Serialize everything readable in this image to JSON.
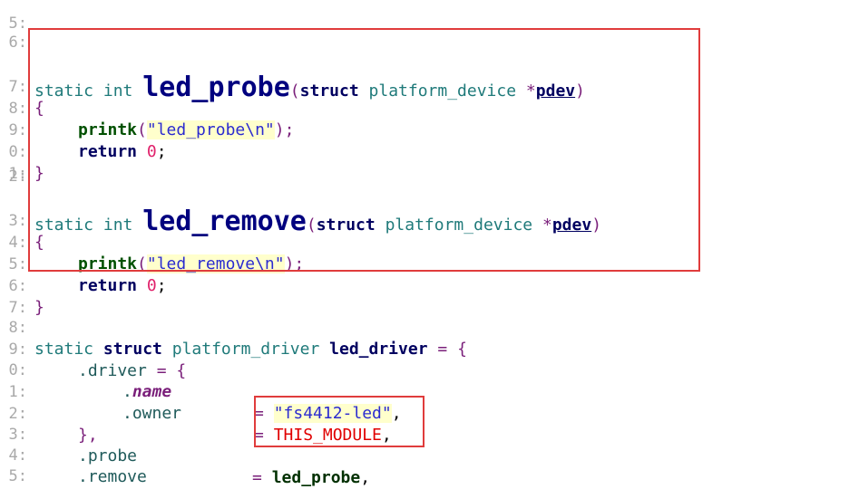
{
  "gutter": {
    "l05": "5:",
    "l06": "6:",
    "l07": "7:",
    "l08": "8:",
    "l09": "9:",
    "l10": "0:",
    "l11": "1:",
    "l12": "2:",
    "l13": "3:",
    "l14": "4:",
    "l15": "5:",
    "l16": "6:",
    "l17": "7:",
    "l18": "8:",
    "l19": "9:",
    "l20": "0:",
    "l21": "1:",
    "l22": "2:",
    "l23": "3:",
    "l24": "4:",
    "l25": "5:",
    "l26": "6:"
  },
  "code": {
    "static": "static",
    "int": "int",
    "struct": "struct",
    "platform_device": "platform_device",
    "star": "*",
    "pdev": "pdev",
    "open_paren": "(",
    "close_paren": ")",
    "open_brace": "{",
    "close_brace": "}",
    "led_probe": "led_probe",
    "led_remove": "led_remove",
    "printk": "printk",
    "str_probe": "\"led_probe\\n\"",
    "str_remove": "\"led_remove\\n\"",
    "return": "return",
    "zero": "0",
    "semicolon": ";",
    "paren_semicolon": ");",
    "platform_driver": "platform_driver",
    "led_driver": "led_driver",
    "eq": "=",
    "dot_driver": ".driver",
    "dot": ".",
    "name": "name",
    "str_name": "\"fs4412-led\"",
    "comma": ",",
    "dot_owner": ".owner",
    "this_module": "THIS_MODULE",
    "close_brace_comma": "},",
    "dot_probe": ".probe",
    "dot_remove": ".remove",
    "close_brace_semicolon": "};"
  }
}
